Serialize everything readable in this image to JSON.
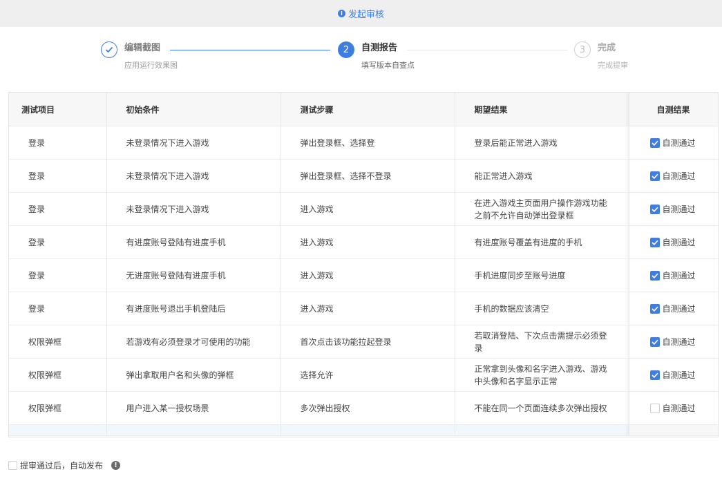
{
  "header": {
    "title": "发起审核",
    "icon": "info-circle-icon"
  },
  "steps": [
    {
      "title": "编辑截图",
      "subtitle": "应用运行效果图",
      "state": "done"
    },
    {
      "number": "2",
      "title": "自测报告",
      "subtitle": "填写版本自查点",
      "state": "active"
    },
    {
      "number": "3",
      "title": "完成",
      "subtitle": "完成提审",
      "state": "todo"
    }
  ],
  "table": {
    "columns": [
      "测试项目",
      "初始条件",
      "测试步骤",
      "期望结果",
      "自测结果"
    ],
    "rows": [
      {
        "item": "登录",
        "condition": "未登录情况下进入游戏",
        "step": "弹出登录框、选择登",
        "expected": "登录后能正常进入游戏",
        "result": "自测通过",
        "checked": true
      },
      {
        "item": "登录",
        "condition": "未登录情况下进入游戏",
        "step": "弹出登录框、选择不登录",
        "expected": "能正常进入游戏",
        "result": "自测通过",
        "checked": true
      },
      {
        "item": "登录",
        "condition": "未登录情况下进入游戏",
        "step": "进入游戏",
        "expected": "在进入游戏主页面用户操作游戏功能之前不允许自动弹出登录框",
        "result": "自测通过",
        "checked": true
      },
      {
        "item": "登录",
        "condition": "有进度账号登陆有进度手机",
        "step": "进入游戏",
        "expected": "有进度账号覆盖有进度的手机",
        "result": "自测通过",
        "checked": true
      },
      {
        "item": "登录",
        "condition": "无进度账号登陆有进度手机",
        "step": "进入游戏",
        "expected": "手机进度同步至账号进度",
        "result": "自测通过",
        "checked": true
      },
      {
        "item": "登录",
        "condition": "有进度账号退出手机登陆后",
        "step": "进入游戏",
        "expected": "手机的数据应该清空",
        "result": "自测通过",
        "checked": true
      },
      {
        "item": "权限弹框",
        "condition": "若游戏有必须登录才可使用的功能",
        "step": "首次点击该功能拉起登录",
        "expected": "若取消登陆、下次点击需提示必须登录",
        "result": "自测通过",
        "checked": true
      },
      {
        "item": "权限弹框",
        "condition": "弹出拿取用户名和头像的弹框",
        "step": "选择允许",
        "expected": "正常拿到头像和名字进入游戏、游戏中头像和名字显示正常",
        "result": "自测通过",
        "checked": true
      },
      {
        "item": "权限弹框",
        "condition": "用户进入某一授权场景",
        "step": "多次弹出授权",
        "expected": "不能在同一个页面连续多次弹出授权",
        "result": "自测通过",
        "checked": false
      }
    ]
  },
  "footer": {
    "auto_publish_label": "提审通过后，自动发布",
    "auto_publish_checked": false,
    "help_icon": "exclamation-circle-icon"
  },
  "colors": {
    "accent": "#3d7ee0",
    "topbar_bg": "#efefef",
    "header_bg": "#f7f7f7"
  }
}
